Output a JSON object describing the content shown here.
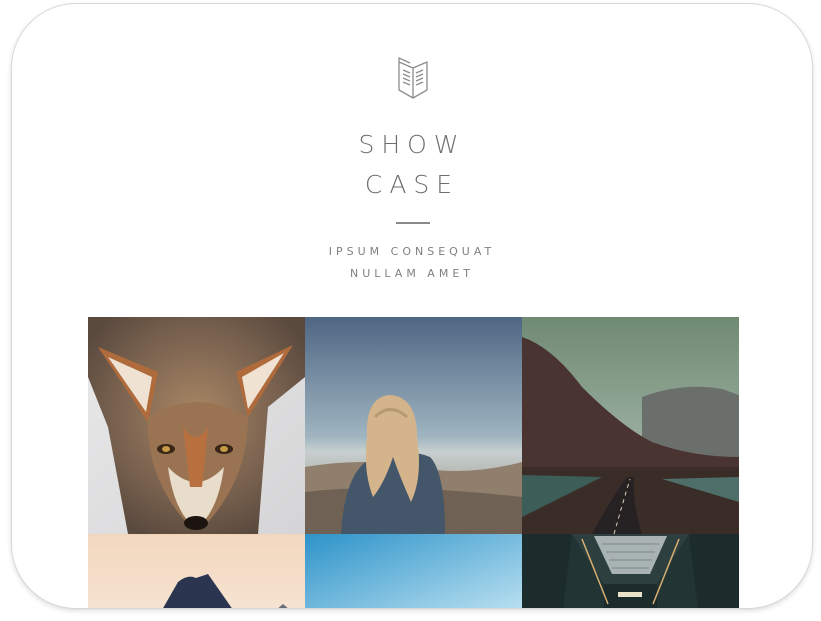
{
  "hero": {
    "logo_icon": "book-icon",
    "title_line1": "SHOW",
    "title_line2": "CASE",
    "subtitle_line1": "IPSUM CONSEQUAT",
    "subtitle_line2": "NULLAM AMET"
  },
  "gallery": {
    "items": [
      {
        "subject": "fox"
      },
      {
        "subject": "woman-overlook"
      },
      {
        "subject": "mountain-road"
      },
      {
        "subject": "mountain-peak"
      },
      {
        "subject": "sky"
      },
      {
        "subject": "tunnel"
      }
    ]
  }
}
